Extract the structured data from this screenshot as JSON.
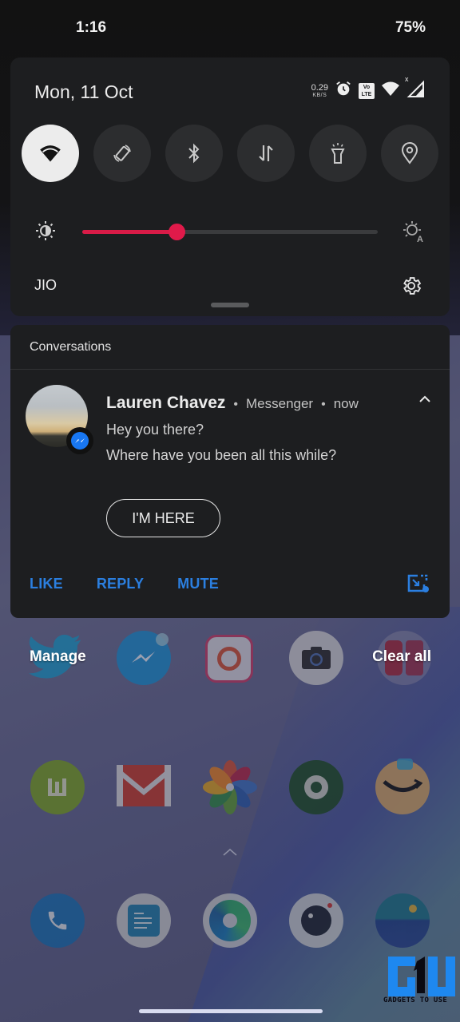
{
  "status_bar": {
    "time": "1:16",
    "battery": "75%"
  },
  "quick_settings": {
    "date": "Mon, 11 Oct",
    "net_speed": {
      "value": "0.29",
      "unit": "KB/S"
    },
    "status_icons": [
      "alarm-icon",
      "volte-icon",
      "wifi-icon",
      "signal-icon"
    ],
    "volte_label": "Vo LTE",
    "signal_badge": "x",
    "tiles": [
      {
        "name": "wifi",
        "icon": "wifi-icon",
        "active": true
      },
      {
        "name": "auto-rotate",
        "icon": "rotate-icon",
        "active": false
      },
      {
        "name": "bluetooth",
        "icon": "bluetooth-icon",
        "active": false
      },
      {
        "name": "mobile-data",
        "icon": "data-arrows-icon",
        "active": false
      },
      {
        "name": "flashlight",
        "icon": "flashlight-icon",
        "active": false
      },
      {
        "name": "location",
        "icon": "location-icon",
        "active": false
      }
    ],
    "brightness": {
      "level": 0.32,
      "accent": "#d81b47"
    },
    "carrier": "JIO"
  },
  "notification": {
    "section_title": "Conversations",
    "sender": "Lauren Chavez",
    "app": "Messenger",
    "time": "now",
    "separator": "•",
    "messages": [
      "Hey you there?",
      "Where have you been all this while?"
    ],
    "smart_reply": "I'M HERE",
    "actions": [
      "LIKE",
      "REPLY",
      "MUTE"
    ],
    "accent": "#2b7fe0"
  },
  "footer": {
    "manage": "Manage",
    "clear_all": "Clear all"
  },
  "home_apps": [
    {
      "name": "twitter",
      "row": 1
    },
    {
      "name": "messenger",
      "row": 1
    },
    {
      "name": "instagram",
      "row": 1
    },
    {
      "name": "camera",
      "row": 1
    },
    {
      "name": "app-folder",
      "row": 1
    },
    {
      "name": "wattpad",
      "row": 2
    },
    {
      "name": "gmail",
      "row": 2
    },
    {
      "name": "photos",
      "row": 2
    },
    {
      "name": "speedtest",
      "row": 2
    },
    {
      "name": "amazon",
      "row": 2
    },
    {
      "name": "phone",
      "row": 3
    },
    {
      "name": "notes",
      "row": 3
    },
    {
      "name": "edge",
      "row": 3
    },
    {
      "name": "camera-app",
      "row": 3
    },
    {
      "name": "gallery",
      "row": 3
    }
  ],
  "watermark": "GADGETS TO USE"
}
